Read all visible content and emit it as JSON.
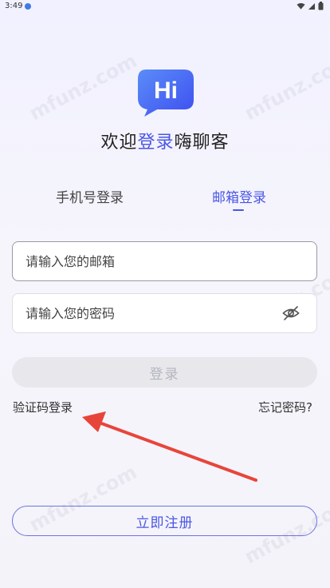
{
  "status_bar": {
    "time": "3:49"
  },
  "brand": {
    "logo_text": "Hi"
  },
  "welcome": {
    "prefix": "欢迎",
    "accent": "登录",
    "suffix": "嗨聊客"
  },
  "tabs": [
    {
      "label": "手机号登录",
      "active": false
    },
    {
      "label": "邮箱登录",
      "active": true
    }
  ],
  "form": {
    "email_placeholder": "请输入您的邮箱",
    "password_placeholder": "请输入您的密码",
    "login_label": "登录"
  },
  "links": {
    "code_login": "验证码登录",
    "forgot_password": "忘记密码?"
  },
  "register": {
    "label": "立即注册"
  },
  "watermark": "mfunz.com",
  "colors": {
    "accent": "#4a56e5",
    "annotation_arrow": "#e8453a"
  },
  "icons": {
    "password_toggle": "eye-off-icon",
    "logo": "chat-bubble-icon"
  }
}
